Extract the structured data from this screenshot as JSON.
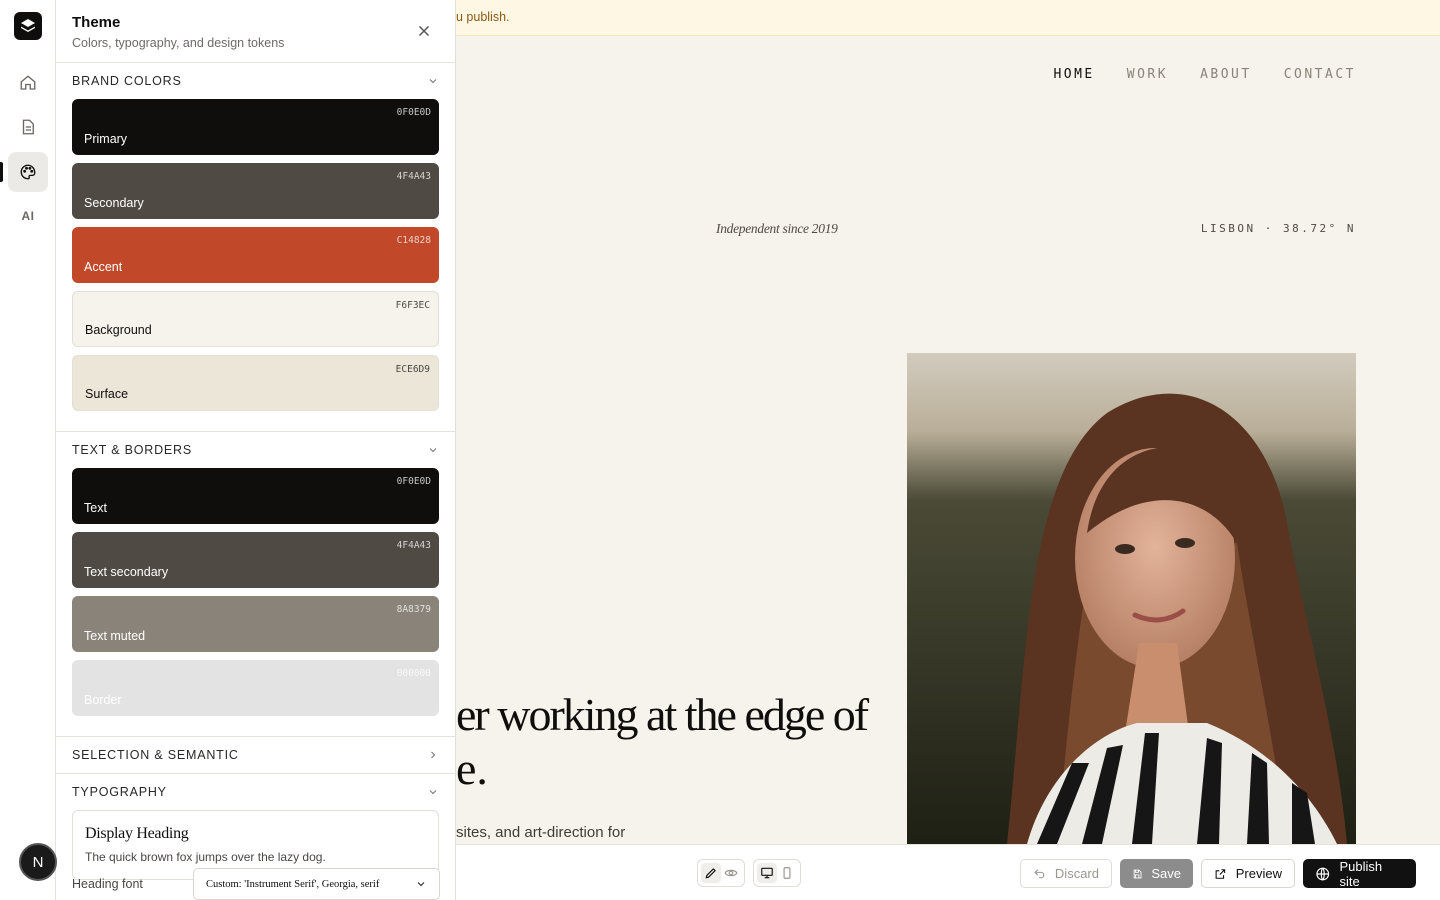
{
  "banner": {
    "text": "u publish."
  },
  "rail": {
    "ai_label": "AI",
    "avatar_initial": "N"
  },
  "panel": {
    "title": "Theme",
    "subtitle": "Colors, typography, and design tokens",
    "brand_colors": {
      "heading": "BRAND COLORS",
      "swatches": [
        {
          "name": "Primary",
          "hex": "0F0E0D",
          "color": "#0F0E0D",
          "text_color": "#FFFFFF"
        },
        {
          "name": "Secondary",
          "hex": "4F4A43",
          "color": "#4F4A43",
          "text_color": "#FFFFFF"
        },
        {
          "name": "Accent",
          "hex": "C14828",
          "color": "#C14828",
          "text_color": "#FFFFFF"
        },
        {
          "name": "Background",
          "hex": "F6F3EC",
          "color": "#F6F3EC",
          "text_color": "#0F0E0D"
        },
        {
          "name": "Surface",
          "hex": "ECE6D9",
          "color": "#ECE6D9",
          "text_color": "#0F0E0D"
        }
      ]
    },
    "text_borders": {
      "heading": "TEXT & BORDERS",
      "swatches": [
        {
          "name": "Text",
          "hex": "0F0E0D",
          "color": "#0F0E0D",
          "text_color": "#FFFFFF"
        },
        {
          "name": "Text secondary",
          "hex": "4F4A43",
          "color": "#4F4A43",
          "text_color": "#FFFFFF"
        },
        {
          "name": "Text muted",
          "hex": "8A8379",
          "color": "#8A8379",
          "text_color": "#FFFFFF"
        },
        {
          "name": "Border",
          "hex": "000000",
          "color": "#E3E3E3",
          "text_color": "#FFFFFF"
        }
      ]
    },
    "selection_semantic": {
      "heading": "SELECTION & SEMANTIC"
    },
    "typography": {
      "heading": "TYPOGRAPHY",
      "display_heading": "Display Heading",
      "sample_text": "The quick brown fox jumps over the lazy dog.",
      "heading_font_label": "Heading font",
      "heading_font_value": "Custom: 'Instrument Serif', Georgia, serif"
    }
  },
  "site": {
    "nav": [
      "HOME",
      "WORK",
      "ABOUT",
      "CONTACT"
    ],
    "nav_active": "HOME",
    "tagline": "Independent since 2019",
    "location": "LISBON · 38.72° N",
    "hero_line1": "er working at the edge of",
    "hero_line2": "e.",
    "subtext": "sites, and art-direction for"
  },
  "toolbar": {
    "discard": "Discard",
    "save": "Save",
    "preview": "Preview",
    "publish": "Publish site"
  }
}
